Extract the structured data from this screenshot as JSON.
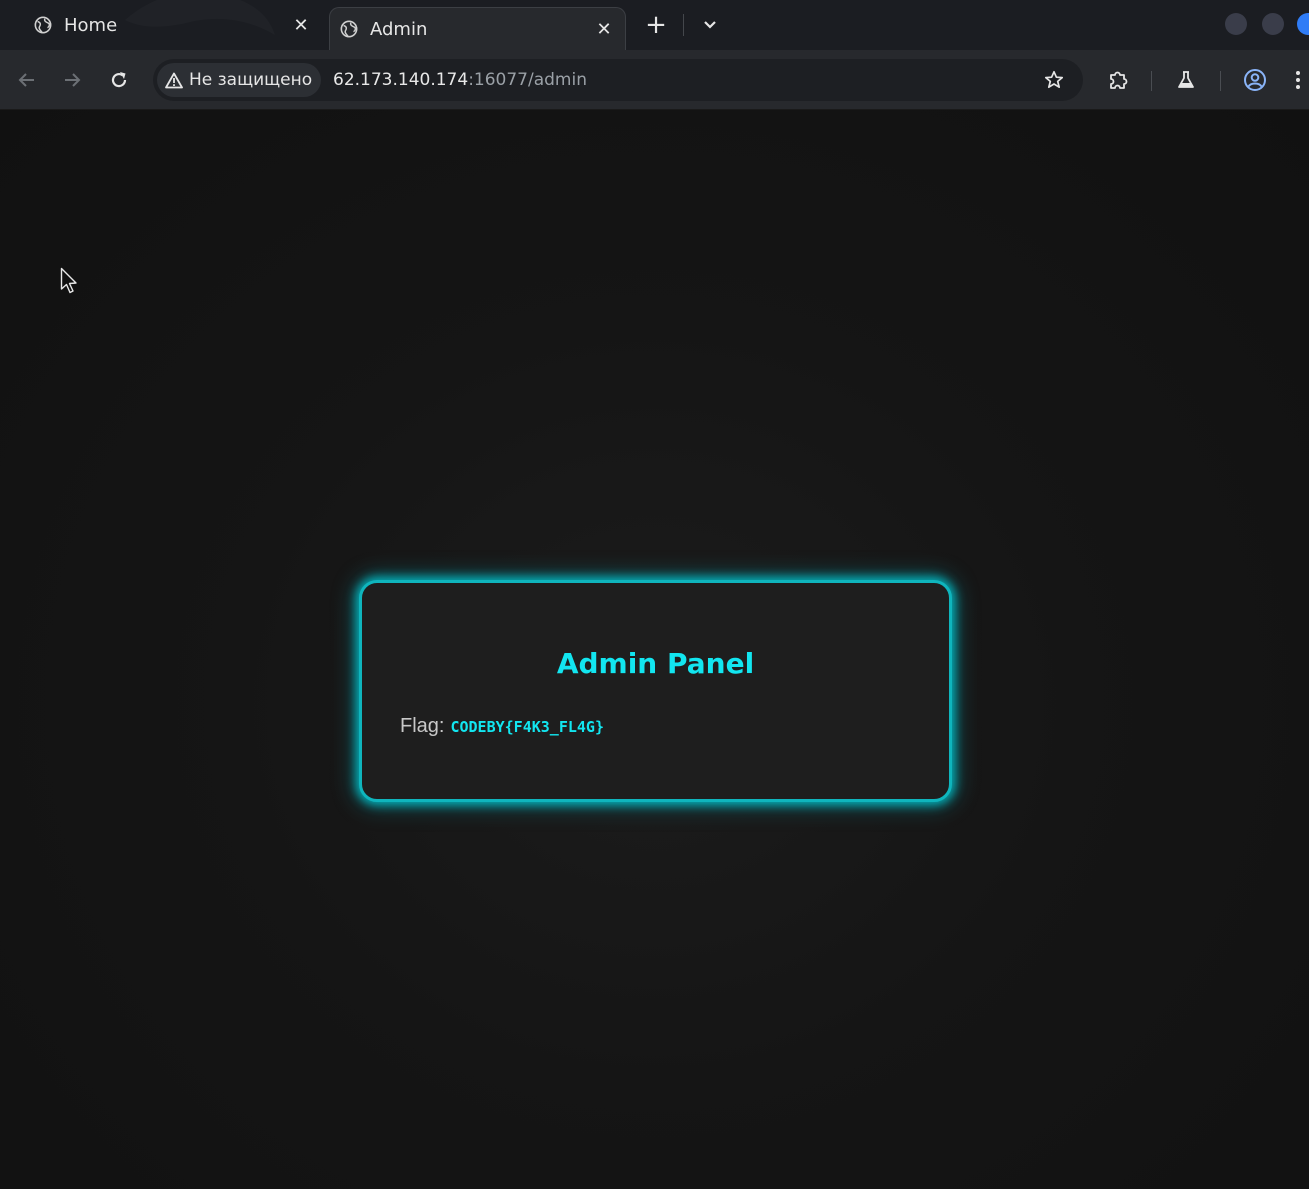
{
  "tabs": [
    {
      "title": "Home",
      "icon": "globe-icon",
      "active": false
    },
    {
      "title": "Admin",
      "icon": "globe-icon",
      "active": true
    }
  ],
  "tabstrip": {
    "new_tab": "+",
    "close_glyph": "✕"
  },
  "toolbar": {
    "security_label": "Не защищено",
    "url_host": "62.173.140.174",
    "url_path": ":16077/admin"
  },
  "page": {
    "title": "Admin Panel",
    "flag_label": "Flag:",
    "flag_value": "CODEBY{F4K3_FL4G}"
  },
  "colors": {
    "accent": "#12e6f0",
    "card_border": "#0fb5bd",
    "page_bg": "#121212",
    "card_bg": "#1e1e1e"
  }
}
